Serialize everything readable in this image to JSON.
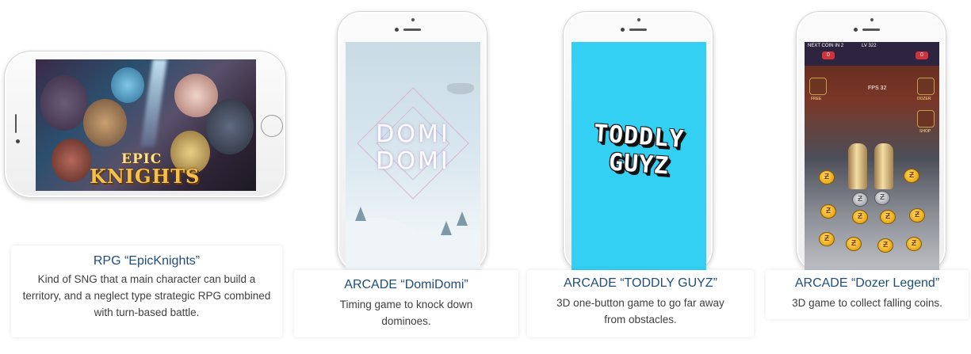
{
  "games": [
    {
      "genre_title": "RPG “EpicKnights”",
      "description": "Kind of SNG that a main character can build a territory, and a neglect type strategic RPG combined with turn-based battle.",
      "logo": {
        "line1": "EPIC",
        "line2": "KNIGHTS"
      }
    },
    {
      "genre_title": "ARCADE “DomiDomi”",
      "description": "Timing game to knock down dominoes.",
      "logo": {
        "line1": "DOMI",
        "line2": "DOMI"
      }
    },
    {
      "genre_title": "ARCADE “TODDLY GUYZ”",
      "description": "3D one-button game to go far away from obstacles.",
      "logo": {
        "line1": "TODDLY",
        "line2": "GUYZ"
      },
      "screen_color": "#33d0f4"
    },
    {
      "genre_title": "ARCADE “Dozer Legend”",
      "description": "3D game to collect falling coins.",
      "hud": {
        "left_label": "NEXT COIN IN 2",
        "level": "LV 322",
        "left_score": "0",
        "right_score": "0",
        "fps": "FPS 32",
        "side_labels": [
          "FREE",
          "DOZER",
          "SHOP"
        ]
      }
    }
  ],
  "colors": {
    "title_blue": "#1f4e79",
    "body_text": "#404040"
  }
}
